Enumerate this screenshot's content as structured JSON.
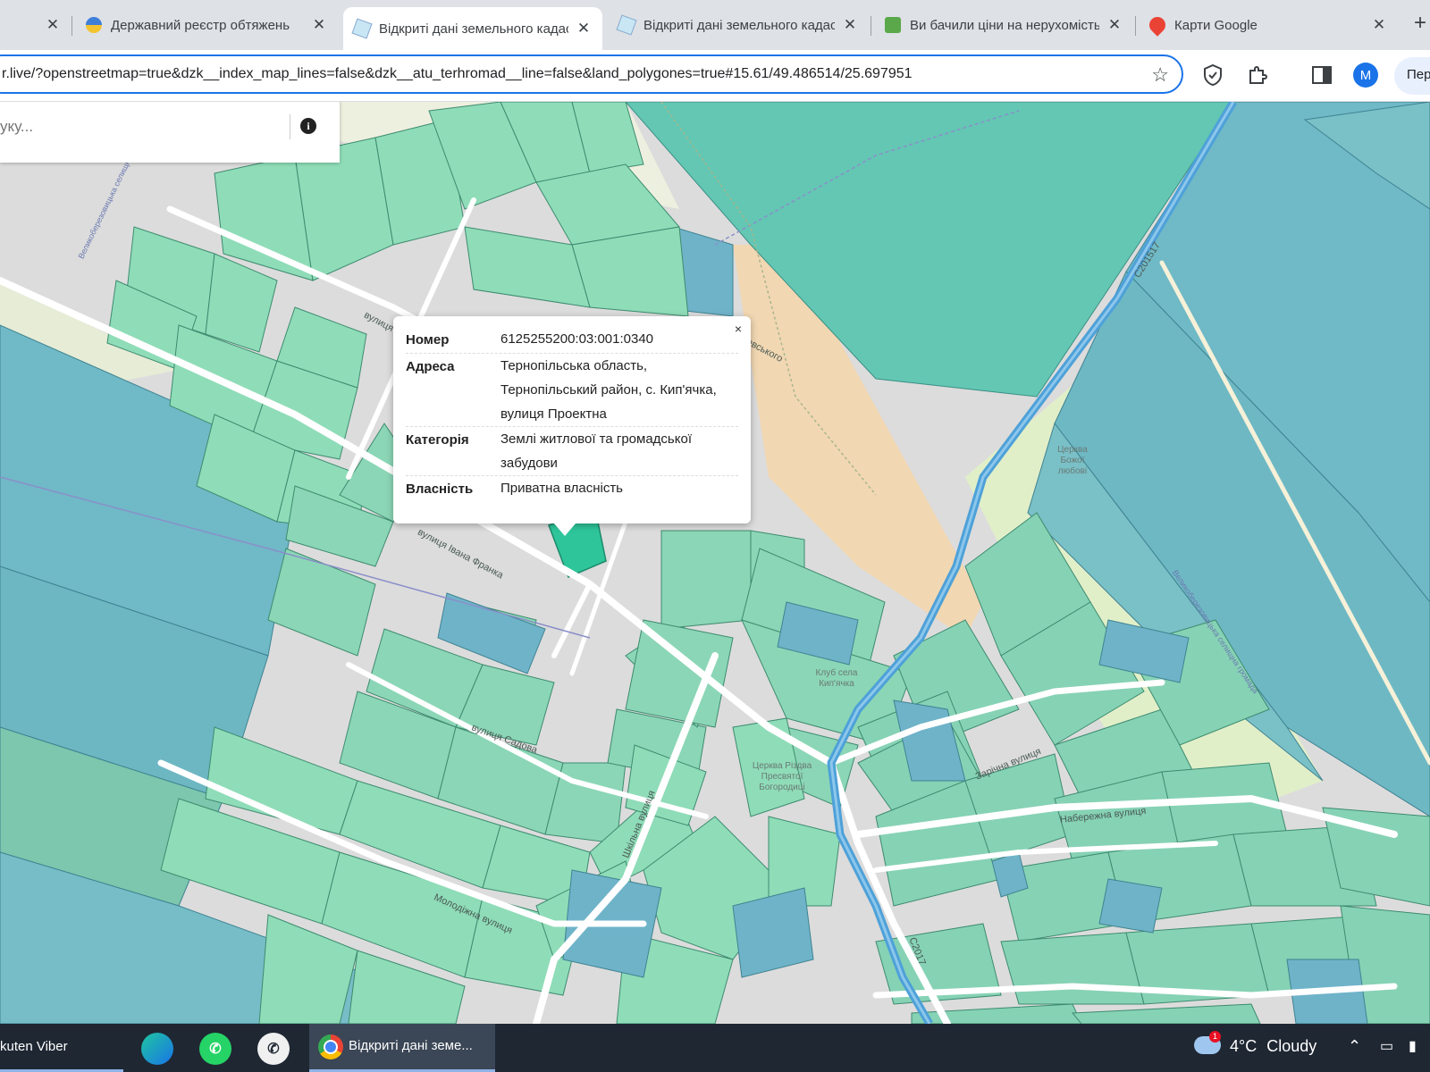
{
  "tabs": [
    {
      "title": "",
      "active": false
    },
    {
      "title": "Державний реєстр обтяжень",
      "active": false
    },
    {
      "title": "Відкриті дані земельного кадастру",
      "active": true
    },
    {
      "title": "Відкриті дані земельного кадастру",
      "active": false
    },
    {
      "title": "Ви бачили ціни на нерухомість",
      "active": false
    },
    {
      "title": "Карти Google",
      "active": false
    }
  ],
  "toolbar": {
    "url": "r.live/?openstreetmap=true&dzk__index_map_lines=false&dzk__atu_terhromad__line=false&land_polygones=true#15.61/49.486514/25.697951",
    "avatar_letter": "M",
    "profile_label": "Пер"
  },
  "search": {
    "placeholder": "уку..."
  },
  "popup": {
    "rows": [
      {
        "key": "Номер",
        "value": "6125255200:03:001:0340"
      },
      {
        "key": "Адреса",
        "value": "Тернопільська область, Тернопільський район, с. Кип'ячка, вулиця Проектна"
      },
      {
        "key": "Категорія",
        "value": "Землі житлової та громадської забудови"
      },
      {
        "key": "Власність",
        "value": "Приватна власність"
      }
    ]
  },
  "map_labels": {
    "street_franka": "вулиця Івана Франка",
    "street_sadova": "вулиця Садова",
    "street_shkilna": "Шкільна вулиця",
    "street_molodizhna": "Молодіжна вулиця",
    "street_zarichna": "Зарічна вулиця",
    "street_naberezhna": "Набережна вулиця",
    "street_vul": "вулиця",
    "street_evskogo": "евського",
    "road_c201517": "С201517",
    "road_c2017": "С2017",
    "hromada_1": "Великоберезовицька селищна громада",
    "hromada_2": "Великоберезовицька селищна громада",
    "poi_club": "Клуб села Кип'ячка",
    "poi_church": "Церква Різдва Пресвятої Богородиці",
    "poi_chapel": "Церква Божої любові"
  },
  "taskbar": {
    "viber_label": "kuten Viber",
    "chrome_label": "Відкриті дані земе...",
    "temperature": "4°C",
    "weather": "Cloudy",
    "notification_count": "1"
  },
  "colors": {
    "parcel_green": "#8fdcb8",
    "parcel_teal": "#79c7c0",
    "parcel_blue": "#6fb3c9",
    "selected_parcel": "#2ec59a",
    "river": "#4ea1d8",
    "accent": "#1a73e8"
  }
}
